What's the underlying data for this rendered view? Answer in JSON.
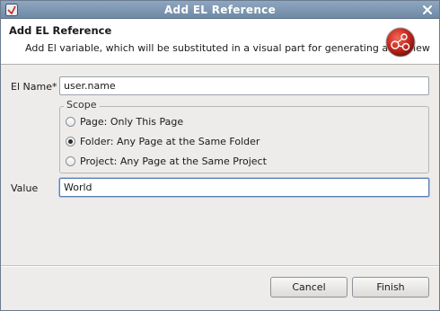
{
  "window": {
    "title": "Add EL Reference"
  },
  "banner": {
    "title": "Add EL Reference",
    "description": "Add El variable, which will be substituted in a visual part for generating a preview"
  },
  "form": {
    "el_name_label": "El Name*",
    "el_name_value": "user.name",
    "scope": {
      "legend": "Scope",
      "options": [
        {
          "label": "Page: Only This Page",
          "checked": false
        },
        {
          "label": "Folder: Any Page at the Same Folder",
          "checked": true
        },
        {
          "label": "Project: Any Page at the Same Project",
          "checked": false
        }
      ]
    },
    "value_label": "Value",
    "value_value": "World"
  },
  "buttons": {
    "cancel_label": "Cancel",
    "finish_label": "Finish"
  },
  "colors": {
    "titlebar": "#7b93ad",
    "accent": "#5b7fb4",
    "logo_red": "#c8281e"
  },
  "icons": {
    "window_menu": "window-menu-icon",
    "close": "close-icon",
    "banner_logo": "el-reference-logo-icon"
  }
}
